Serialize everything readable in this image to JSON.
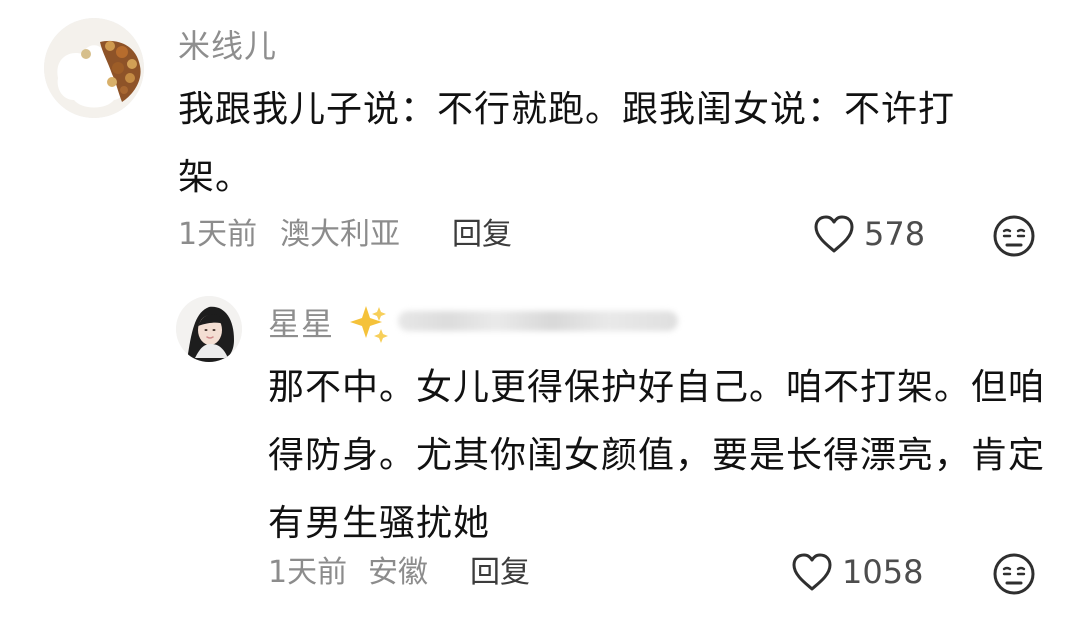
{
  "comment": {
    "author": "米线儿",
    "text": "我跟我儿子说：不行就跑。跟我闺女说：不许打架。",
    "time": "1天前",
    "location": "澳大利亚",
    "reply_label": "回复",
    "likes": "578",
    "icons": {
      "avatar": "food-avatar",
      "like": "heart-icon",
      "reaction": "neutral-face-icon"
    }
  },
  "reply": {
    "author": "星星",
    "text": "那不中。女儿更得保护好自己。咱不打架。但咱得防身。尤其你闺女颜值，要是长得漂亮，肯定有男生骚扰她",
    "time": "1天前",
    "location": "安徽",
    "reply_label": "回复",
    "likes": "1058",
    "icons": {
      "avatar": "portrait-avatar",
      "sparkles": "sparkles-icon",
      "like": "heart-icon",
      "reaction": "neutral-face-icon"
    }
  },
  "colors": {
    "primary_text": "#111111",
    "secondary_text": "#8c8c8c",
    "username_text": "#8e8e8e",
    "reply_text": "#3c3c3c",
    "sparkle": "#f5c23a"
  }
}
